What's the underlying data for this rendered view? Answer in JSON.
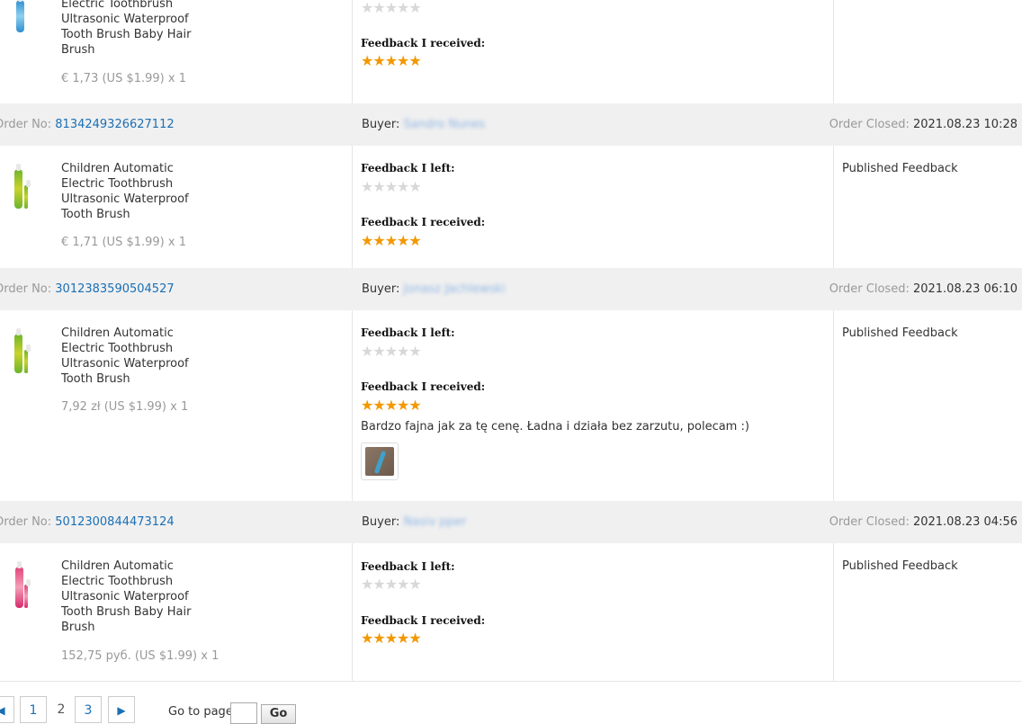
{
  "orders": [
    {
      "title": "Electric Toothbrush Ultrasonic Waterproof Tooth Brush Baby Hair Brush",
      "price": "€ 1,73 (US $1.99) x 1",
      "feedback_received_label": "Feedback I received:"
    },
    {
      "order_no_label": "Order No:",
      "order_no": "8134249326627112",
      "buyer_label": "Buyer:",
      "buyer_name": "Sandro Nunes",
      "closed_label": "Order Closed:",
      "closed_date": "2021.08.23 10:28",
      "title": "Children Automatic Electric Toothbrush Ultrasonic Waterproof Tooth Brush",
      "price": "€ 1,71 (US $1.99) x 1",
      "feedback_left_label": "Feedback I left:",
      "feedback_received_label": "Feedback I received:",
      "status": "Published Feedback"
    },
    {
      "order_no_label": "Order No:",
      "order_no": "3012383590504527",
      "buyer_label": "Buyer:",
      "buyer_name": "Jonasz Jachlewski",
      "closed_label": "Order Closed:",
      "closed_date": "2021.08.23 06:10",
      "title": "Children Automatic Electric Toothbrush Ultrasonic Waterproof Tooth Brush",
      "price": "7,92 zł (US $1.99) x 1",
      "feedback_left_label": "Feedback I left:",
      "feedback_received_label": "Feedback I received:",
      "comment": "Bardzo fajna jak za tę cenę. Ładna i działa bez zarzutu, polecam :)",
      "status": "Published Feedback"
    },
    {
      "order_no_label": "Order No:",
      "order_no": "5012300844473124",
      "buyer_label": "Buyer:",
      "buyer_name": "Nasiv pper",
      "closed_label": "Order Closed:",
      "closed_date": "2021.08.23 04:56",
      "title": "Children Automatic Electric Toothbrush Ultrasonic Waterproof Tooth Brush Baby Hair Brush",
      "price": "152,75 руб. (US $1.99) x 1",
      "feedback_left_label": "Feedback I left:",
      "feedback_received_label": "Feedback I received:",
      "status": "Published Feedback"
    }
  ],
  "ratings": {
    "left": 0,
    "received": 5,
    "max": 5
  },
  "stars": {
    "glyph": "★★★★★"
  },
  "colors": {
    "link": "#1a6fb5",
    "star_filled": "#f39800",
    "star_empty": "#d8d8d8",
    "header_bg": "#f0f0f0"
  },
  "pagination": {
    "pages": [
      "1",
      "2",
      "3"
    ],
    "current": "2",
    "goto_label": "Go to page",
    "go_button": "Go",
    "prev_icon": "◀",
    "next_icon": "▶"
  }
}
